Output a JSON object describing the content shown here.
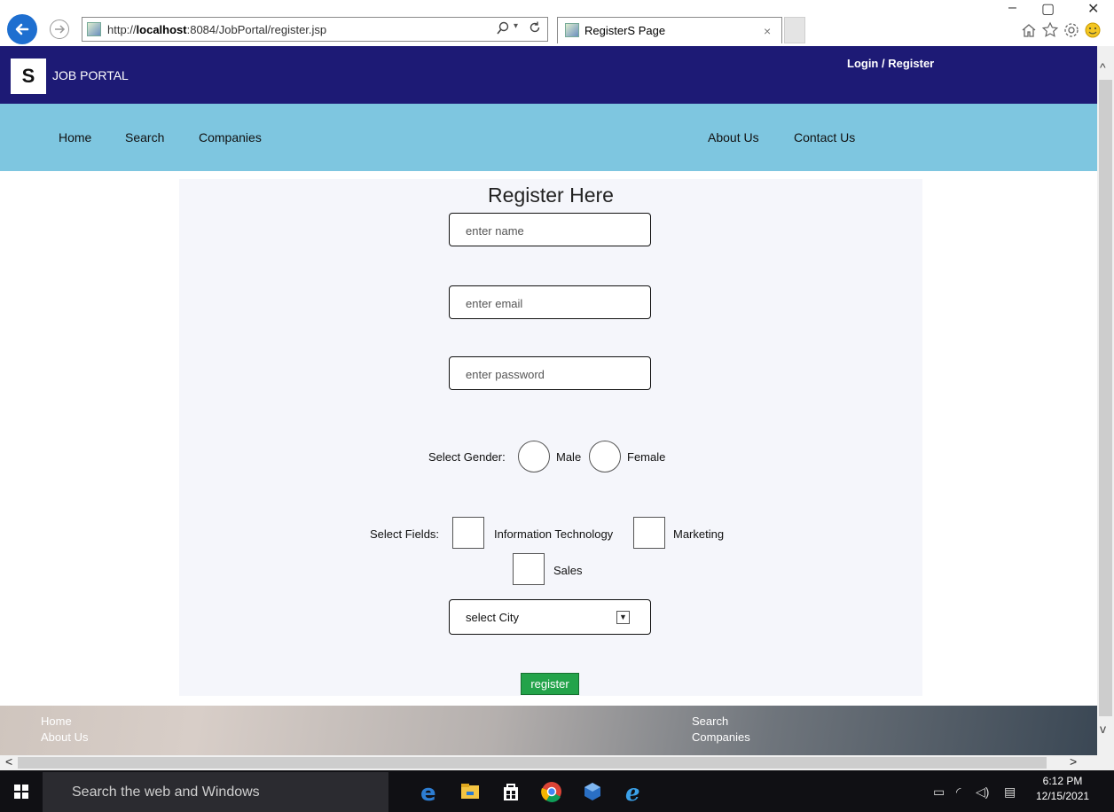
{
  "browser": {
    "url_prefix": "http://",
    "url_host": "localhost",
    "url_rest": ":8084/JobPortal/register.jsp",
    "tab_title": "RegisterS Page",
    "tab_close": "×",
    "addr_dropdown": "▾",
    "window_controls": {
      "minimize": "–",
      "maximize": "▢",
      "close": "✕"
    }
  },
  "header": {
    "logo_glyph": "S",
    "brand": "JOB PORTAL",
    "login_register": "Login / Register"
  },
  "nav": {
    "home": "Home",
    "search": "Search",
    "companies": "Companies",
    "about": "About Us",
    "contact": "Contact Us"
  },
  "form": {
    "title": "Register Here",
    "name_placeholder": "enter name",
    "email_placeholder": "enter email",
    "password_placeholder": "enter password",
    "gender_label": "Select Gender:",
    "gender_male": "Male",
    "gender_female": "Female",
    "fields_label": "Select Fields:",
    "field_it": "Information Technology",
    "field_marketing": "Marketing",
    "field_sales": "Sales",
    "city_selected": "select City",
    "register_label": "register"
  },
  "footer": {
    "home": "Home",
    "about": "About Us",
    "search": "Search",
    "companies": "Companies"
  },
  "taskbar": {
    "search_placeholder": "Search the web and Windows",
    "time": "6:12 PM",
    "date": "12/15/2021"
  },
  "colors": {
    "header_bg": "#1d1a75",
    "nav_bg": "#7ec6e0",
    "register_button": "#23a34a"
  }
}
